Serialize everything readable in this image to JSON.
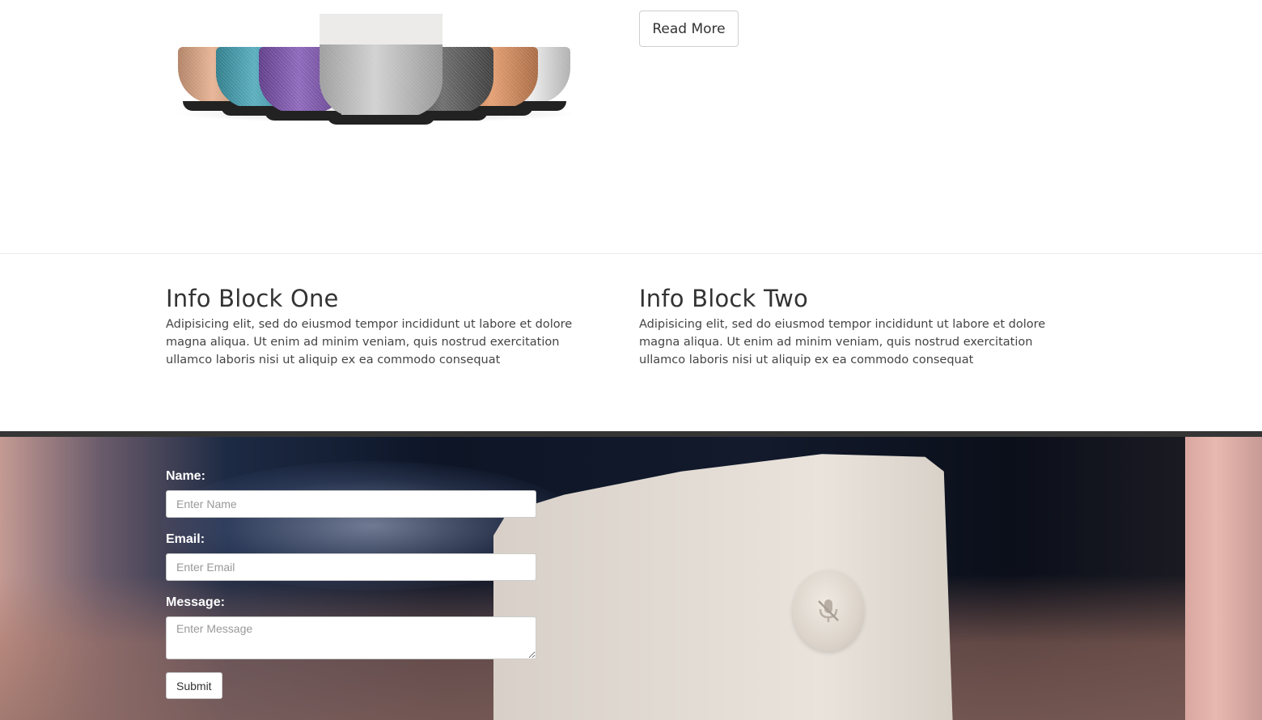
{
  "hero": {
    "read_more_label": "Read More",
    "speaker_colors": [
      "#e3a783",
      "#3ea0b3",
      "#7b4fb0",
      "#c9c9c9",
      "#555555",
      "#e08f5b",
      "#ebebeb"
    ]
  },
  "info": {
    "blocks": [
      {
        "title": "Info Block One",
        "text": "Adipisicing elit, sed do eiusmod tempor incididunt ut labore et dolore magna aliqua. Ut enim ad minim veniam, quis nostrud exercitation ullamco laboris nisi ut aliquip ex ea commodo consequat"
      },
      {
        "title": "Info Block Two",
        "text": "Adipisicing elit, sed do eiusmod tempor incididunt ut labore et dolore magna aliqua. Ut enim ad minim veniam, quis nostrud exercitation ullamco laboris nisi ut aliquip ex ea commodo consequat"
      }
    ]
  },
  "contact": {
    "name_label": "Name:",
    "name_placeholder": "Enter Name",
    "email_label": "Email:",
    "email_placeholder": "Enter Email",
    "message_label": "Message:",
    "message_placeholder": "Enter Message",
    "submit_label": "Submit"
  },
  "icons": {
    "mic": "mic-off-icon"
  }
}
